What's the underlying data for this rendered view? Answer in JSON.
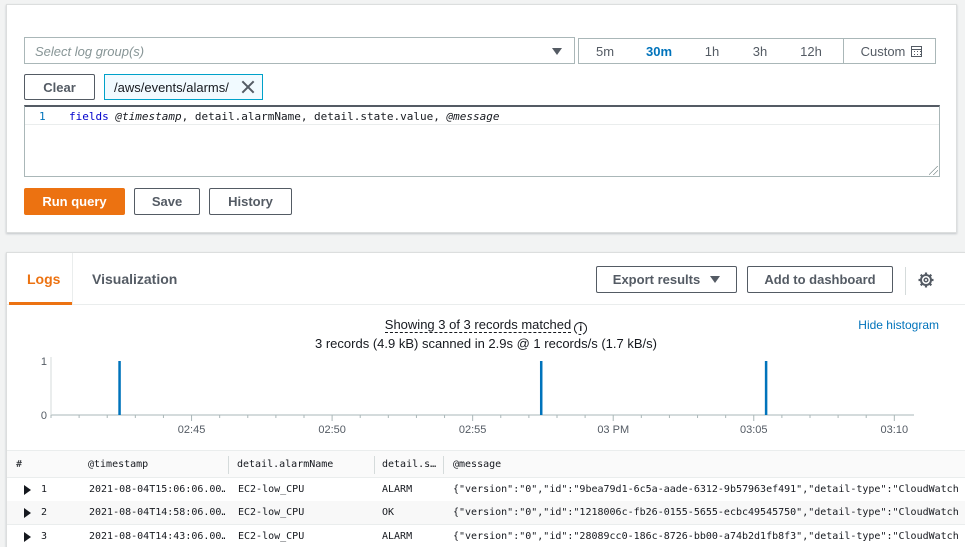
{
  "query": {
    "log_group_placeholder": "Select log group(s)",
    "time_ranges": [
      "5m",
      "30m",
      "1h",
      "3h",
      "12h"
    ],
    "active_range": "30m",
    "custom_label": "Custom",
    "clear_label": "Clear",
    "selected_log_group": "/aws/events/alarms/",
    "editor": {
      "line_number": "1",
      "kw": "fields",
      "f1": "@timestamp",
      "f2": ", detail.alarmName, detail.state.value, ",
      "f3": "@message"
    },
    "run_label": "Run query",
    "save_label": "Save",
    "history_label": "History"
  },
  "results": {
    "tabs": [
      "Logs",
      "Visualization"
    ],
    "export_label": "Export results",
    "add_dashboard_label": "Add to dashboard",
    "summary": "Showing 3 of 3 records matched",
    "stats": "3 records (4.9 kB) scanned in 2.9s @ 1 records/s (1.7 kB/s)",
    "hide_histogram": "Hide histogram",
    "columns": [
      "#",
      "@timestamp",
      "detail.alarmName",
      "detail.s…",
      "@message"
    ],
    "rows": [
      {
        "n": "1",
        "ts": "2021-08-04T15:06:06.00…",
        "alarm": "EC2-low_CPU",
        "state": "ALARM",
        "msg": "{\"version\":\"0\",\"id\":\"9bea79d1-6c5a-aade-6312-9b57963ef491\",\"detail-type\":\"CloudWatch"
      },
      {
        "n": "2",
        "ts": "2021-08-04T14:58:06.00…",
        "alarm": "EC2-low_CPU",
        "state": "OK",
        "msg": "{\"version\":\"0\",\"id\":\"1218006c-fb26-0155-5655-ecbc49545750\",\"detail-type\":\"CloudWatch"
      },
      {
        "n": "3",
        "ts": "2021-08-04T14:43:06.00…",
        "alarm": "EC2-low_CPU",
        "state": "ALARM",
        "msg": "{\"version\":\"0\",\"id\":\"28089cc0-186c-8726-bb00-a74b2d1fb8f3\",\"detail-type\":\"CloudWatch"
      }
    ]
  },
  "chart_data": {
    "type": "bar",
    "title": "",
    "xlabel": "",
    "ylabel": "",
    "x_tick_labels": [
      "02:45",
      "02:50",
      "02:55",
      "03 PM",
      "03:05",
      "03:10"
    ],
    "x_tick_minutes": [
      165,
      170,
      175,
      180,
      185,
      190
    ],
    "y_tick_labels": [
      "0",
      "1"
    ],
    "ylim": [
      0,
      1
    ],
    "xlim_minutes": [
      160.0,
      190.7
    ],
    "points": [
      {
        "x_minutes": 162.43,
        "value": 1
      },
      {
        "x_minutes": 177.43,
        "value": 1
      },
      {
        "x_minutes": 185.43,
        "value": 1
      }
    ],
    "bar_color": "#0073bb",
    "grid": false
  }
}
